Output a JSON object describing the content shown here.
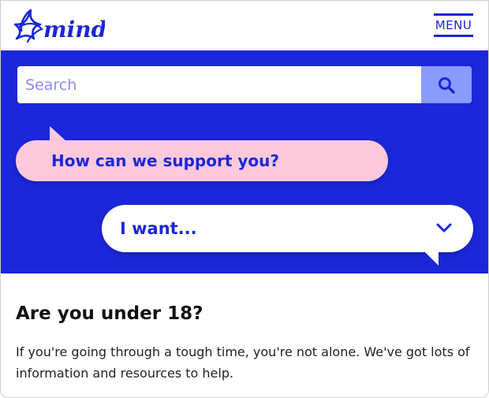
{
  "header": {
    "logo_text": "mind",
    "menu_label": "MENU"
  },
  "search": {
    "placeholder": "Search"
  },
  "hero": {
    "support_question": "How can we support you?",
    "want_label": "I want..."
  },
  "section": {
    "title": "Are you under 18?",
    "body": "If you're going through a tough time, you're not alone. We've got lots of information and resources to help."
  },
  "colors": {
    "brand_blue": "#1b27d9",
    "pink": "#ffc9dc",
    "search_button": "#8a9bff"
  }
}
